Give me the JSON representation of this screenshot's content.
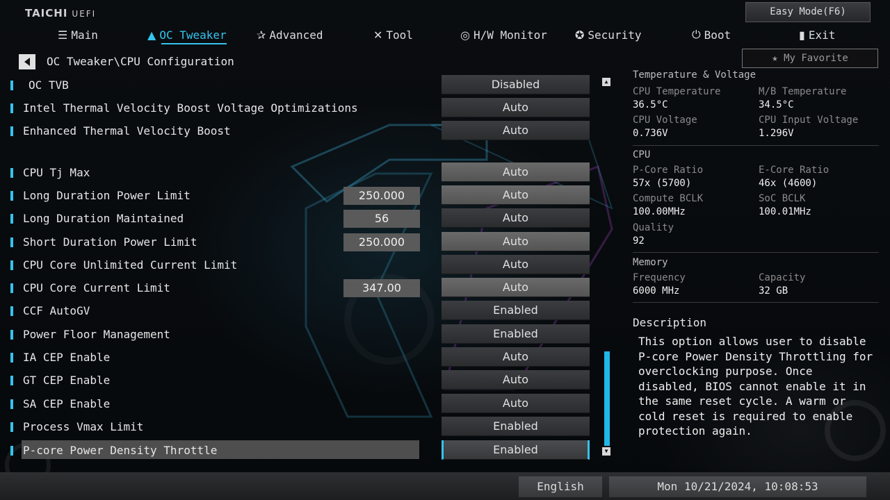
{
  "brand": {
    "name": "TAICHI",
    "suffix": "UEFI"
  },
  "easy_mode_label": "Easy Mode(F6)",
  "nav": [
    {
      "label": "Main",
      "icon": "list-icon"
    },
    {
      "label": "OC Tweaker",
      "icon": "rocket-icon",
      "active": true
    },
    {
      "label": "Advanced",
      "icon": "star-arrow-icon"
    },
    {
      "label": "Tool",
      "icon": "tools-icon"
    },
    {
      "label": "H/W Monitor",
      "icon": "monitor-icon"
    },
    {
      "label": "Security",
      "icon": "shield-icon"
    },
    {
      "label": "Boot",
      "icon": "power-icon"
    },
    {
      "label": "Exit",
      "icon": "exit-icon"
    }
  ],
  "breadcrumb": "OC Tweaker\\CPU Configuration",
  "favorite_label": "My Favorite",
  "settings": [
    {
      "label": "OC TVB",
      "value": "Disabled"
    },
    {
      "label": "Intel Thermal Velocity Boost Voltage Optimizations",
      "value": "Auto"
    },
    {
      "label": "Enhanced Thermal Velocity Boost",
      "value": "Auto"
    },
    {
      "label": "CPU Tj Max",
      "value": "Auto"
    },
    {
      "label": "Long Duration Power Limit",
      "number": "250.000",
      "value": "Auto"
    },
    {
      "label": "Long Duration Maintained",
      "number": "56",
      "value": "Auto"
    },
    {
      "label": "Short Duration Power Limit",
      "number": "250.000",
      "value": "Auto"
    },
    {
      "label": "CPU Core Unlimited Current Limit",
      "value": "Auto"
    },
    {
      "label": "CPU Core Current Limit",
      "number": "347.00",
      "value": "Auto"
    },
    {
      "label": "CCF AutoGV",
      "value": "Enabled"
    },
    {
      "label": "Power Floor Management",
      "value": "Enabled"
    },
    {
      "label": "IA CEP Enable",
      "value": "Auto"
    },
    {
      "label": "GT CEP Enable",
      "value": "Auto"
    },
    {
      "label": "SA CEP Enable",
      "value": "Auto"
    },
    {
      "label": "Process Vmax Limit",
      "value": "Enabled"
    },
    {
      "label": "P-core Power Density Throttle",
      "value": "Enabled",
      "selected": true
    }
  ],
  "monitor": {
    "temp_voltage": {
      "title": "Temperature & Voltage",
      "cpu_temp_label": "CPU Temperature",
      "cpu_temp": "36.5°C",
      "mb_temp_label": "M/B Temperature",
      "mb_temp": "34.5°C",
      "cpu_voltage_label": "CPU Voltage",
      "cpu_voltage": "0.736V",
      "cpu_input_voltage_label": "CPU Input Voltage",
      "cpu_input_voltage": "1.296V"
    },
    "cpu": {
      "title": "CPU",
      "pcore_ratio_label": "P-Core Ratio",
      "pcore_ratio": "57x (5700)",
      "ecore_ratio_label": "E-Core Ratio",
      "ecore_ratio": "46x (4600)",
      "compute_bclk_label": "Compute BCLK",
      "compute_bclk": "100.00MHz",
      "soc_bclk_label": "SoC BCLK",
      "soc_bclk": "100.01MHz",
      "quality_label": "Quality",
      "quality": "92"
    },
    "memory": {
      "title": "Memory",
      "frequency_label": "Frequency",
      "frequency": "6000 MHz",
      "capacity_label": "Capacity",
      "capacity": "32 GB"
    }
  },
  "description": {
    "title": "Description",
    "text": "This option allows user to disable P-core Power Density Throttling for overclocking purpose. Once disabled, BIOS cannot enable it in the same reset cycle. A warm or cold reset is required to enable protection again."
  },
  "footer": {
    "language": "English",
    "datetime": "Mon 10/21/2024, 10:08:53"
  },
  "colors": {
    "accent": "#34c4ee",
    "background": "#05080b"
  }
}
